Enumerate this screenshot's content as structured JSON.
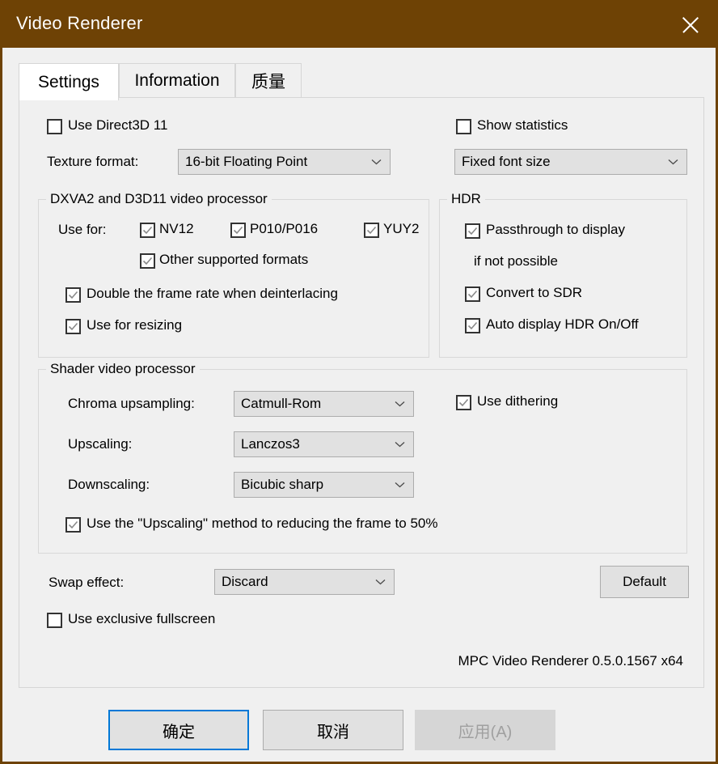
{
  "window": {
    "title": "Video Renderer",
    "close_icon": "close-icon",
    "accent_color": "#6e4205",
    "panel_bg": "#f0f0f0",
    "focus_color": "#0078d7"
  },
  "tabs": [
    {
      "label": "Settings",
      "active": true
    },
    {
      "label": "Information",
      "active": false
    },
    {
      "label": "质量",
      "active": false
    }
  ],
  "settings": {
    "use_direct3d11": {
      "label": "Use Direct3D 11",
      "checked": false
    },
    "texture_format": {
      "label": "Texture format:",
      "value": "16-bit Floating Point"
    },
    "show_statistics": {
      "label": "Show statistics",
      "checked": false
    },
    "font_size": {
      "value": "Fixed font size"
    },
    "dxva_group": {
      "title": "DXVA2 and D3D11 video processor",
      "use_for_label": "Use for:",
      "formats": [
        {
          "label": "NV12",
          "checked": true
        },
        {
          "label": "P010/P016",
          "checked": true
        },
        {
          "label": "YUY2",
          "checked": true
        },
        {
          "label": "Other supported formats",
          "checked": true
        }
      ],
      "double_frame_rate": {
        "label": "Double the frame rate when deinterlacing",
        "checked": true
      },
      "use_for_resizing": {
        "label": "Use for resizing",
        "checked": true
      }
    },
    "hdr_group": {
      "title": "HDR",
      "passthrough": {
        "label": "Passthrough to display",
        "checked": true
      },
      "if_not_possible": "if not possible",
      "convert_sdr": {
        "label": "Convert to SDR",
        "checked": true
      },
      "auto_display": {
        "label": "Auto display HDR On/Off",
        "checked": true
      }
    },
    "shader_group": {
      "title": "Shader video processor",
      "chroma_upsampling": {
        "label": "Chroma upsampling:",
        "value": "Catmull-Rom"
      },
      "upscaling": {
        "label": "Upscaling:",
        "value": "Lanczos3"
      },
      "downscaling": {
        "label": "Downscaling:",
        "value": "Bicubic sharp"
      },
      "use_dithering": {
        "label": "Use dithering",
        "checked": true
      },
      "use_upscaling_method": {
        "label": "Use the \"Upscaling\" method to reducing the frame to 50%",
        "checked": true
      }
    },
    "swap_effect": {
      "label": "Swap effect:",
      "value": "Discard"
    },
    "exclusive_fullscreen": {
      "label": "Use exclusive fullscreen",
      "checked": false
    },
    "default_button": "Default",
    "version_text": "MPC Video Renderer 0.5.0.1567 x64"
  },
  "footer": {
    "ok": "确定",
    "cancel": "取消",
    "apply": "应用(A)"
  }
}
